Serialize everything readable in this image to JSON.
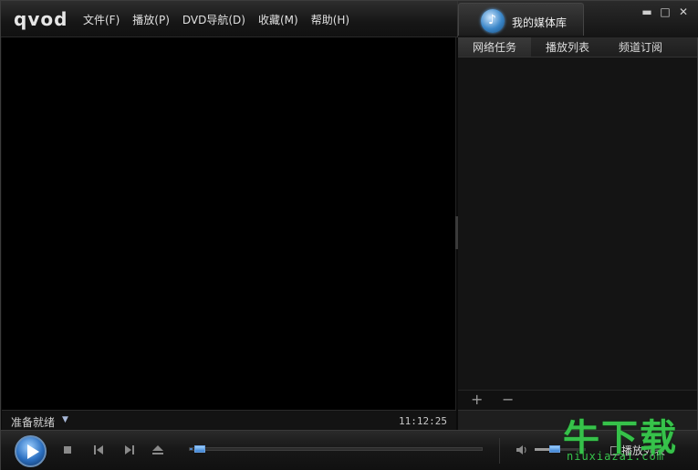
{
  "app": {
    "logo": "qvod"
  },
  "menu": [
    {
      "label": "文件(F)"
    },
    {
      "label": "播放(P)"
    },
    {
      "label": "DVD导航(D)"
    },
    {
      "label": "收藏(M)"
    },
    {
      "label": "帮助(H)"
    }
  ],
  "media_library": {
    "label": "我的媒体库",
    "icon": "music-note-icon"
  },
  "window_controls": {
    "minimize": "▬",
    "maximize": "□",
    "close": "✕"
  },
  "right_panel": {
    "tabs": [
      {
        "label": "网络任务"
      },
      {
        "label": "播放列表"
      },
      {
        "label": "频道订阅"
      }
    ],
    "add_symbol": "+",
    "remove_symbol": "−"
  },
  "status": {
    "text": "准备就绪",
    "dropdown_arrow": "▼",
    "time": "11:12:25"
  },
  "controls": {
    "seek_progress": 0.01,
    "volume_level": 0.4,
    "playlist_label": "播放列表",
    "accent_color": "#2b6fc0"
  },
  "watermark": {
    "brand": "牛下载",
    "domain": "niuxiazai.com"
  }
}
